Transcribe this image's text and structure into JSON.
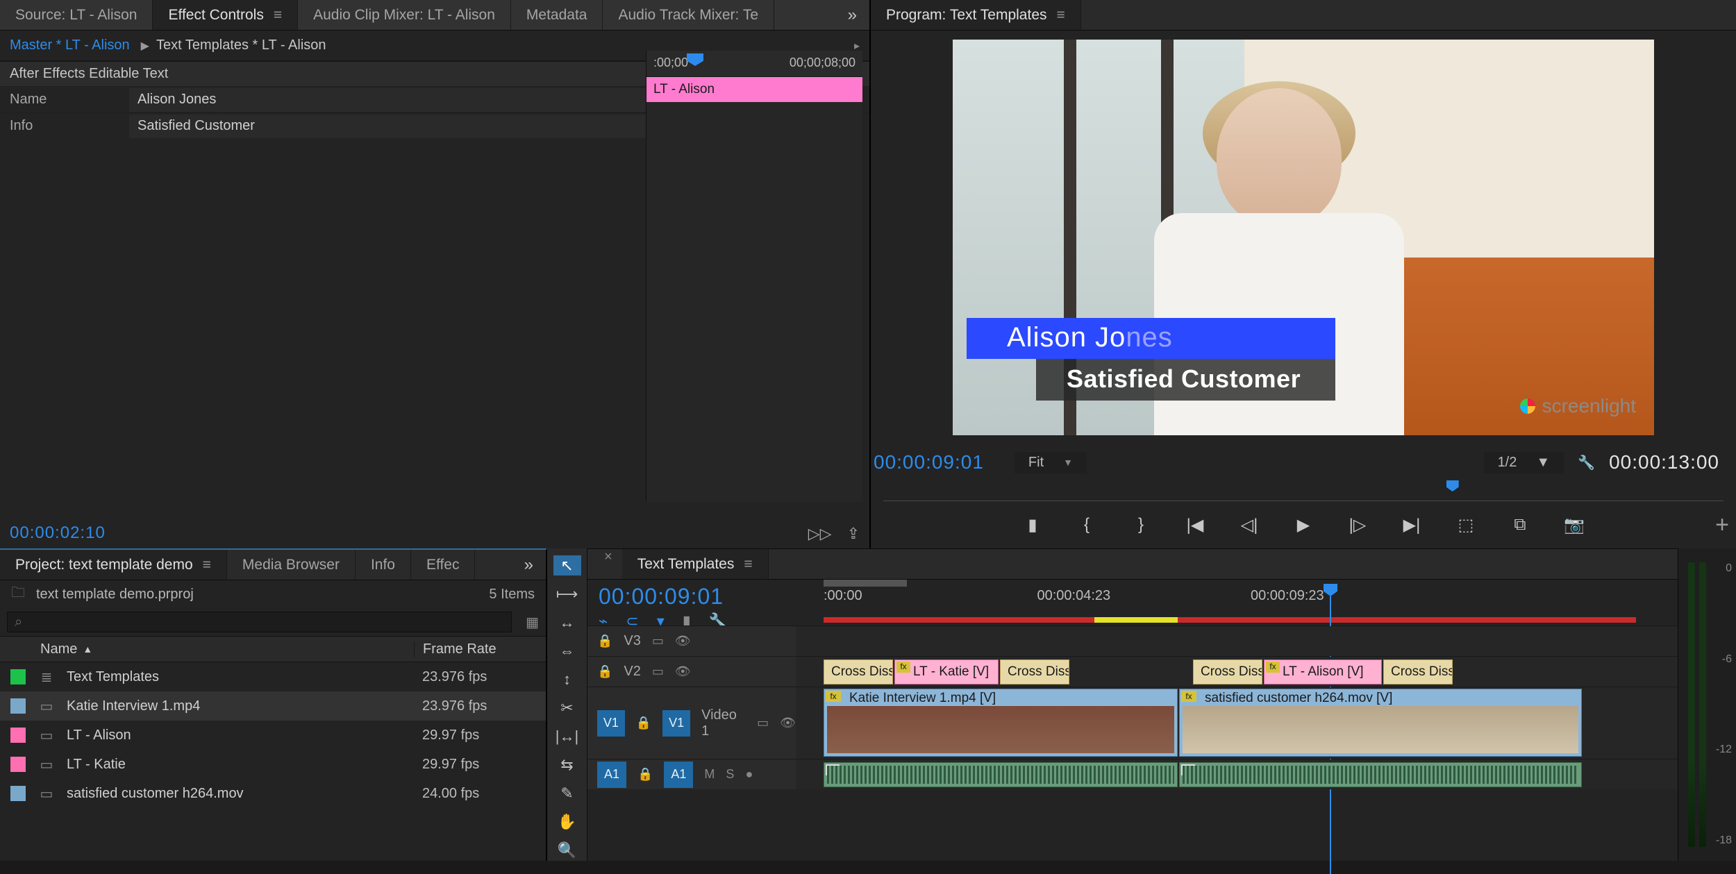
{
  "source_tabs": {
    "source": "Source: LT - Alison",
    "effect_controls": "Effect Controls",
    "audio_clip_mixer": "Audio Clip Mixer: LT - Alison",
    "metadata": "Metadata",
    "audio_track_mixer": "Audio Track Mixer: Te"
  },
  "effect_controls": {
    "master": "Master * LT - Alison",
    "applied": "Text Templates * LT - Alison",
    "section": "After Effects Editable Text",
    "rows": {
      "name_label": "Name",
      "name_value": "Alison Jones",
      "info_label": "Info",
      "info_value": "Satisfied Customer"
    },
    "mini": {
      "t0": ":00;00",
      "t1": "00;00;08;00",
      "clip": "LT - Alison"
    },
    "current_tc": "00:00:02:10"
  },
  "program": {
    "tab": "Program: Text Templates",
    "lower_third": {
      "name_a": "Alison Jo",
      "name_b": "nes",
      "subtitle": "Satisfied Customer"
    },
    "logo": "screenlight",
    "tc_current": "00:00:09:01",
    "fit": "Fit",
    "scale": "1/2",
    "tc_end": "00:00:13:00"
  },
  "project": {
    "tab": "Project: text template demo",
    "tabs": {
      "media": "Media Browser",
      "info": "Info",
      "effects": "Effec"
    },
    "file": "text template demo.prproj",
    "item_count": "5 Items",
    "columns": {
      "name": "Name",
      "frame_rate": "Frame Rate"
    },
    "items": [
      {
        "chip": "green",
        "name": "Text Templates",
        "fps": "23.976 fps"
      },
      {
        "chip": "blue",
        "name": "Katie Interview 1.mp4",
        "fps": "23.976 fps"
      },
      {
        "chip": "pink",
        "name": "LT - Alison",
        "fps": "29.97 fps"
      },
      {
        "chip": "pink",
        "name": "LT - Katie",
        "fps": "29.97 fps"
      },
      {
        "chip": "blue",
        "name": "satisfied customer h264.mov",
        "fps": "24.00 fps"
      }
    ]
  },
  "timeline": {
    "tab": "Text Templates",
    "tc": "00:00:09:01",
    "ruler": {
      "t0": ":00:00",
      "t1": "00:00:04:23",
      "t2": "00:00:09:23"
    },
    "tracks": {
      "v3": "V3",
      "v2": "V2",
      "v1": "V1",
      "video1": "Video 1",
      "a1": "A1"
    },
    "clips": {
      "lt_katie": "LT - Katie [V]",
      "lt_alison": "LT - Alison [V]",
      "cross": "Cross Diss",
      "katie": "Katie Interview 1.mp4 [V]",
      "customer": "satisfied customer h264.mov [V]"
    },
    "toggles": {
      "mute": "M",
      "solo": "S"
    }
  },
  "meter_labels": [
    "0",
    "-6",
    "-12",
    "-18"
  ]
}
